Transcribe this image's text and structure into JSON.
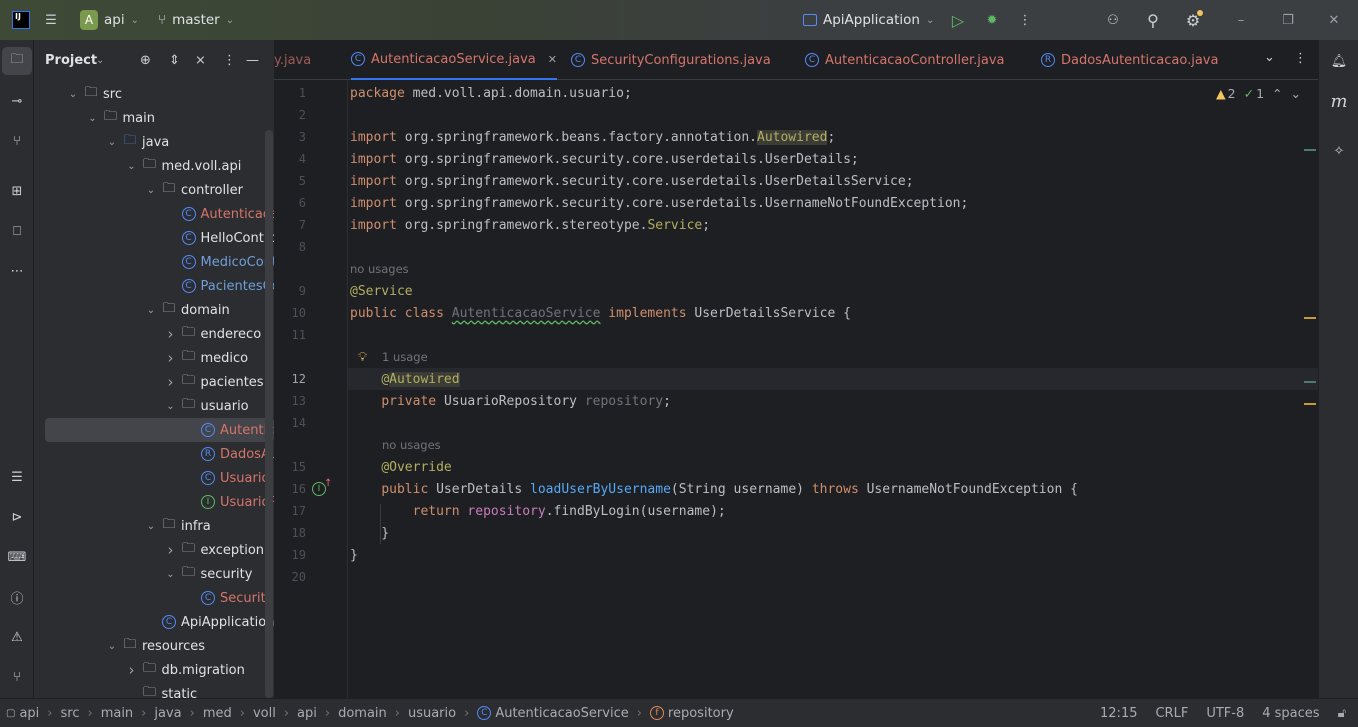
{
  "titlebar": {
    "project": "api",
    "project_badge": "A",
    "branch": "master",
    "run_config": "ApiApplication"
  },
  "project_panel": {
    "title": "Project",
    "tree": [
      {
        "label": "src",
        "level": 0,
        "chevron": "open",
        "icon": "folder",
        "color": "#DFE1E5"
      },
      {
        "label": "main",
        "level": 1,
        "chevron": "open",
        "icon": "folder",
        "color": "#DFE1E5"
      },
      {
        "label": "java",
        "level": 2,
        "chevron": "open",
        "icon": "folder-source",
        "color": "#DFE1E5"
      },
      {
        "label": "med.voll.api",
        "level": 3,
        "chevron": "open",
        "icon": "package",
        "color": "#DFE1E5"
      },
      {
        "label": "controller",
        "level": 4,
        "chevron": "open",
        "icon": "package",
        "color": "#DFE1E5"
      },
      {
        "label": "Autenticaca",
        "level": 5,
        "chevron": "none",
        "icon": "class",
        "color": "#D5756C"
      },
      {
        "label": "HelloContro",
        "level": 5,
        "chevron": "none",
        "icon": "class",
        "color": "#DFE1E5"
      },
      {
        "label": "MedicoCont",
        "level": 5,
        "chevron": "none",
        "icon": "class",
        "color": "#6F9FD8"
      },
      {
        "label": "PacientesCo",
        "level": 5,
        "chevron": "none",
        "icon": "class",
        "color": "#6F9FD8"
      },
      {
        "label": "domain",
        "level": 4,
        "chevron": "open",
        "icon": "package",
        "color": "#DFE1E5"
      },
      {
        "label": "endereco",
        "level": 5,
        "chevron": "closed",
        "icon": "package",
        "color": "#DFE1E5"
      },
      {
        "label": "medico",
        "level": 5,
        "chevron": "closed",
        "icon": "package",
        "color": "#DFE1E5"
      },
      {
        "label": "pacientes",
        "level": 5,
        "chevron": "closed",
        "icon": "package",
        "color": "#DFE1E5"
      },
      {
        "label": "usuario",
        "level": 5,
        "chevron": "open",
        "icon": "package",
        "color": "#DFE1E5"
      },
      {
        "label": "Autentica",
        "level": 6,
        "chevron": "none",
        "icon": "class",
        "color": "#D5756C",
        "selected": true
      },
      {
        "label": "DadosAu",
        "level": 6,
        "chevron": "none",
        "icon": "record",
        "color": "#D5756C"
      },
      {
        "label": "Usuario",
        "level": 6,
        "chevron": "none",
        "icon": "class",
        "color": "#D5756C"
      },
      {
        "label": "UsuarioR",
        "level": 6,
        "chevron": "none",
        "icon": "interface",
        "color": "#D5756C"
      },
      {
        "label": "infra",
        "level": 4,
        "chevron": "open",
        "icon": "package",
        "color": "#DFE1E5"
      },
      {
        "label": "exception",
        "level": 5,
        "chevron": "closed",
        "icon": "package",
        "color": "#DFE1E5"
      },
      {
        "label": "security",
        "level": 5,
        "chevron": "open",
        "icon": "package",
        "color": "#DFE1E5"
      },
      {
        "label": "SecurityC",
        "level": 6,
        "chevron": "none",
        "icon": "class",
        "color": "#D5756C"
      },
      {
        "label": "ApiApplication",
        "level": 4,
        "chevron": "none",
        "icon": "class",
        "color": "#DFE1E5"
      },
      {
        "label": "resources",
        "level": 2,
        "chevron": "open",
        "icon": "folder-resources",
        "color": "#DFE1E5"
      },
      {
        "label": "db.migration",
        "level": 3,
        "chevron": "closed",
        "icon": "folder",
        "color": "#DFE1E5"
      },
      {
        "label": "static",
        "level": 3,
        "chevron": "none",
        "icon": "folder",
        "color": "#DFE1E5"
      }
    ]
  },
  "tabs": [
    {
      "label": "y.java",
      "icon": "none"
    },
    {
      "label": "AutenticacaoService.java",
      "icon": "C",
      "active": true,
      "closable": true
    },
    {
      "label": "SecurityConfigurations.java",
      "icon": "C"
    },
    {
      "label": "AutenticacaoController.java",
      "icon": "C"
    },
    {
      "label": "DadosAutenticacao.java",
      "icon": "R"
    }
  ],
  "inspections": {
    "warnings": "2",
    "weak_warnings": "1"
  },
  "code": [
    {
      "n": "1",
      "t": [
        [
          "kw",
          "package "
        ],
        [
          "df",
          "med.voll.api.domain.usuario;"
        ]
      ]
    },
    {
      "n": "2",
      "t": []
    },
    {
      "n": "3",
      "t": [
        [
          "kw",
          "import "
        ],
        [
          "df",
          "org.springframework.beans.factory.annotation."
        ],
        [
          "an hl",
          "Autowired"
        ],
        [
          "df",
          ";"
        ]
      ]
    },
    {
      "n": "4",
      "t": [
        [
          "kw",
          "import "
        ],
        [
          "df",
          "org.springframework.security.core.userdetails.UserDetails;"
        ]
      ]
    },
    {
      "n": "5",
      "t": [
        [
          "kw",
          "import "
        ],
        [
          "df",
          "org.springframework.security.core.userdetails.UserDetailsService;"
        ]
      ]
    },
    {
      "n": "6",
      "t": [
        [
          "kw",
          "import "
        ],
        [
          "df",
          "org.springframework.security.core.userdetails.UsernameNotFoundException;"
        ]
      ]
    },
    {
      "n": "7",
      "t": [
        [
          "kw",
          "import "
        ],
        [
          "df",
          "org.springframework.stereotype."
        ],
        [
          "an",
          "Service"
        ],
        [
          "df",
          ";"
        ]
      ]
    },
    {
      "n": "8",
      "t": []
    },
    {
      "inlay": "no usages",
      "indent": 0
    },
    {
      "n": "9",
      "t": [
        [
          "an",
          "@Service"
        ]
      ]
    },
    {
      "n": "10",
      "t": [
        [
          "kw",
          "public class "
        ],
        [
          "unused wavy",
          "AutenticacaoService"
        ],
        [
          "kw",
          " implements "
        ],
        [
          "df",
          "UserDetailsService {"
        ]
      ]
    },
    {
      "n": "11",
      "t": []
    },
    {
      "inlay": "1 usage",
      "indent": 1,
      "bulb": true
    },
    {
      "n": "12",
      "t": [
        [
          "df",
          "    "
        ],
        [
          "an",
          "@"
        ],
        [
          "an hl",
          "Autowired"
        ]
      ],
      "current": true
    },
    {
      "n": "13",
      "t": [
        [
          "df",
          "    "
        ],
        [
          "kw",
          "private "
        ],
        [
          "df",
          "UsuarioRepository "
        ],
        [
          "unused",
          "repository"
        ],
        [
          "df",
          ";"
        ]
      ]
    },
    {
      "n": "14",
      "t": []
    },
    {
      "inlay": "no usages",
      "indent": 1
    },
    {
      "n": "15",
      "t": [
        [
          "df",
          "    "
        ],
        [
          "an",
          "@Override"
        ]
      ]
    },
    {
      "n": "16",
      "t": [
        [
          "df",
          "    "
        ],
        [
          "kw",
          "public "
        ],
        [
          "df",
          "UserDetails "
        ],
        [
          "fn",
          "loadUserByUsername"
        ],
        [
          "df",
          "(String username) "
        ],
        [
          "kw",
          "throws "
        ],
        [
          "df",
          "UsernameNotFoundException {"
        ]
      ],
      "gutter_icon": "implements-method"
    },
    {
      "n": "17",
      "t": [
        [
          "df",
          "        "
        ],
        [
          "kw",
          "return "
        ],
        [
          "fld",
          "repository"
        ],
        [
          "df",
          ".findByLogin(username);"
        ]
      ]
    },
    {
      "n": "18",
      "t": [
        [
          "df",
          "    }"
        ]
      ]
    },
    {
      "n": "19",
      "t": [
        [
          "df",
          "}"
        ]
      ]
    },
    {
      "n": "20",
      "t": []
    }
  ],
  "breadcrumbs": [
    "api",
    "src",
    "main",
    "java",
    "med",
    "voll",
    "api",
    "domain",
    "usuario",
    "AutenticacaoService",
    "repository"
  ],
  "status": {
    "position": "12:15",
    "line_separator": "CRLF",
    "encoding": "UTF-8",
    "indent": "4 spaces"
  },
  "colors": {
    "accent": "#3574F0",
    "error_file": "#D5756C",
    "modified_file": "#6F9FD8",
    "keyword": "#CF8E6D",
    "annotation": "#B3AE60",
    "method": "#56A8F5",
    "field": "#C77DBB"
  }
}
